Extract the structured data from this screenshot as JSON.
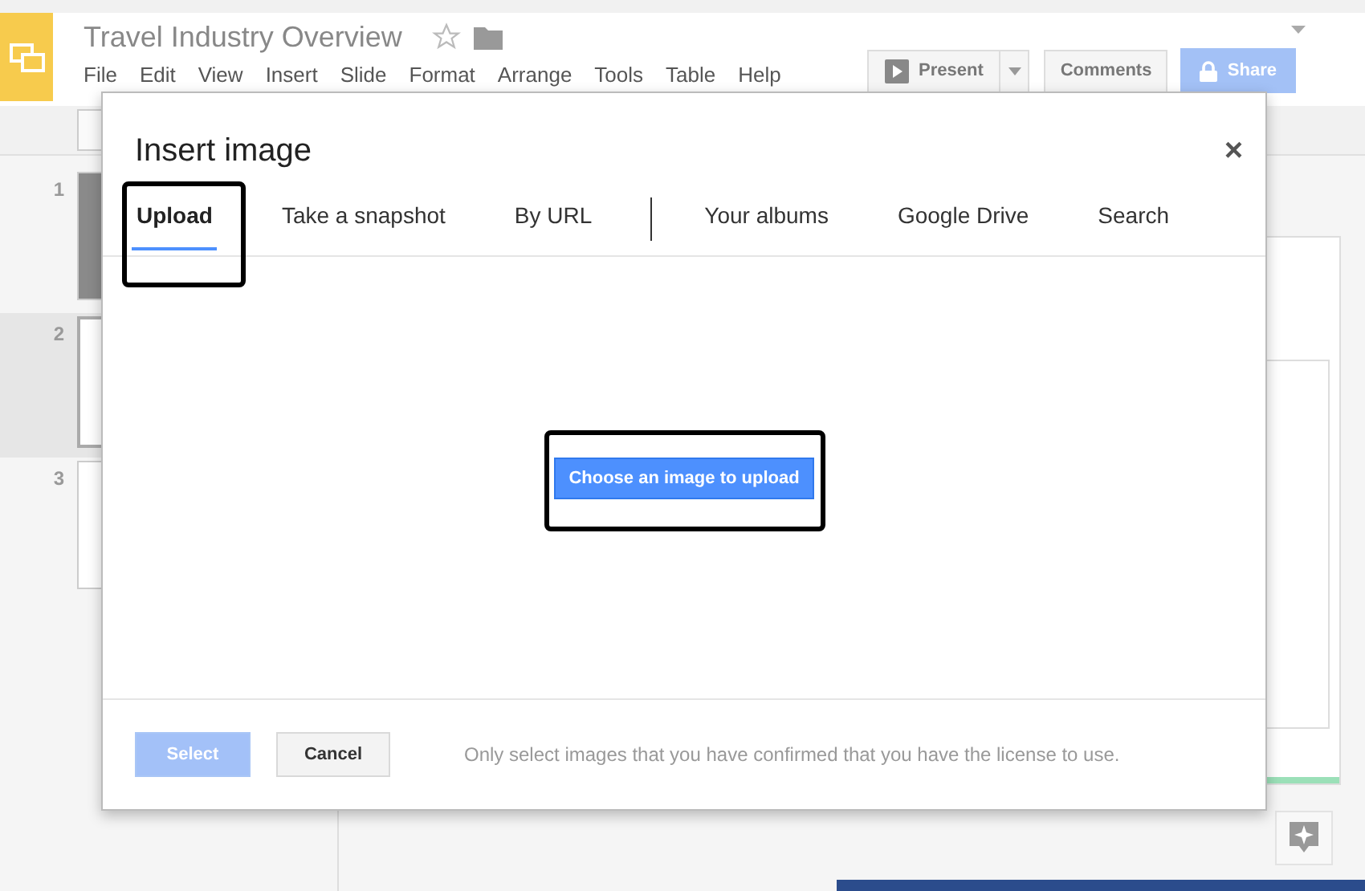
{
  "app": {
    "title": "Travel Industry Overview",
    "starred": false,
    "menu": [
      "File",
      "Edit",
      "View",
      "Insert",
      "Slide",
      "Format",
      "Arrange",
      "Tools",
      "Table",
      "Help"
    ],
    "present": "Present",
    "comments": "Comments",
    "share": "Share"
  },
  "slides": [
    {
      "number": "1",
      "selected": false
    },
    {
      "number": "2",
      "selected": true
    },
    {
      "number": "3",
      "selected": false
    }
  ],
  "dialog": {
    "title": "Insert image",
    "close": "×",
    "tab_groups": [
      [
        {
          "label": "Upload",
          "selected": true
        },
        {
          "label": "Take a snapshot",
          "selected": false
        },
        {
          "label": "By URL",
          "selected": false
        }
      ],
      [
        {
          "label": "Your albums",
          "selected": false
        },
        {
          "label": "Google Drive",
          "selected": false
        },
        {
          "label": "Search",
          "selected": false
        }
      ]
    ],
    "upload_button": "Choose an image to upload",
    "select_button": {
      "label": "Select",
      "disabled": true
    },
    "cancel_button": "Cancel",
    "note": "Only select images that you have confirmed that you have the license to use."
  }
}
